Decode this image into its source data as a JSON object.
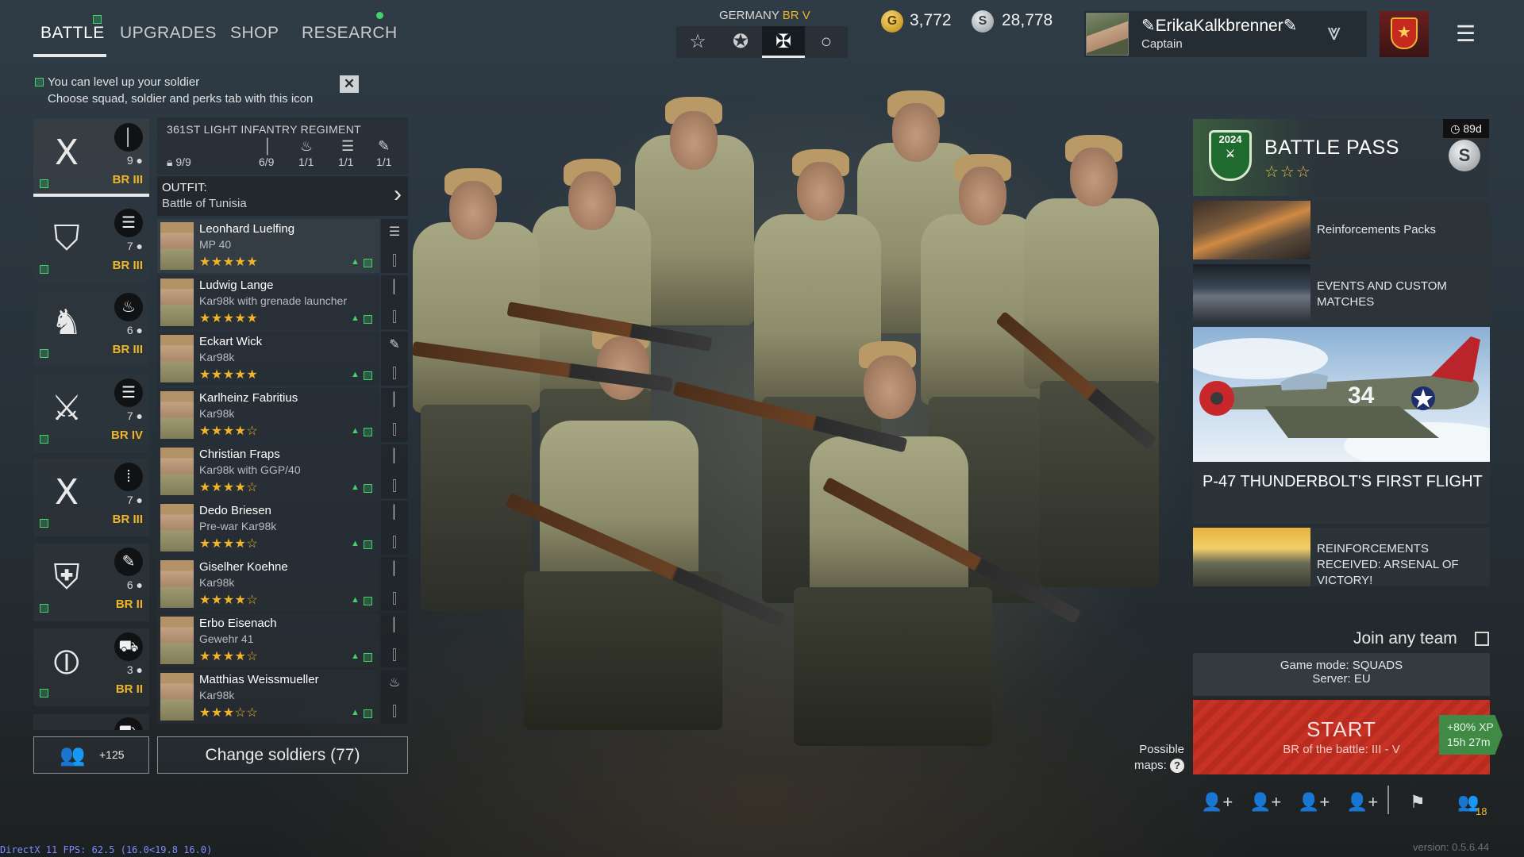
{
  "nav": {
    "tabs": [
      {
        "label": "BATTLE",
        "active": true
      },
      {
        "label": "UPGRADES"
      },
      {
        "label": "SHOP"
      },
      {
        "label": "RESEARCH"
      }
    ]
  },
  "hint": {
    "line1": "You can level up your soldier",
    "line2": "Choose squad, soldier and perks tab with this icon"
  },
  "nation": {
    "name": "GERMANY",
    "br": "BR V",
    "buttons": [
      "star-icon",
      "roundel-star-icon",
      "iron-cross-icon",
      "circle-icon"
    ]
  },
  "currency": {
    "gold_symbol": "G",
    "gold": "3,772",
    "silver_symbol": "S",
    "silver": "28,778"
  },
  "profile": {
    "nickname": "ErikaKalkbrenner",
    "rank": "Captain"
  },
  "squads": [
    {
      "emblem": "Ⅹ",
      "type_icon": "rifle-icon",
      "type_glyph": "│",
      "count": "9",
      "br": "BR III",
      "selected": true
    },
    {
      "emblem": "⛉",
      "type_icon": "list-icon",
      "type_glyph": "☰",
      "count": "7",
      "br": "BR III"
    },
    {
      "emblem": "♞",
      "type_icon": "flame-icon",
      "type_glyph": "♨",
      "count": "6",
      "br": "BR III"
    },
    {
      "emblem": "⚔",
      "type_icon": "list-icon",
      "type_glyph": "☰",
      "count": "7",
      "br": "BR IV"
    },
    {
      "emblem": "Ⅹ",
      "type_icon": "ammo-icon",
      "type_glyph": "⁞",
      "count": "7",
      "br": "BR III"
    },
    {
      "emblem": "⛨",
      "type_icon": "wrench-icon",
      "type_glyph": "✎",
      "count": "6",
      "br": "BR II"
    },
    {
      "emblem": "⦶",
      "type_icon": "tank-icon",
      "type_glyph": "⛟",
      "count": "3",
      "br": "BR II"
    }
  ],
  "squad_bottom": {
    "label": "+125"
  },
  "regiment": {
    "name": "361ST LIGHT INFANTRY REGIMENT",
    "lock_count": "9/9",
    "stats": [
      {
        "icon": "rifle-icon",
        "glyph": "│",
        "value": "6/9"
      },
      {
        "icon": "flame-icon",
        "glyph": "♨",
        "value": "1/1"
      },
      {
        "icon": "list-icon",
        "glyph": "☰",
        "value": "1/1"
      },
      {
        "icon": "wrench-icon",
        "glyph": "✎",
        "value": "1/1"
      }
    ]
  },
  "outfit": {
    "label": "OUTFIT:",
    "value": "Battle of Tunisia"
  },
  "soldiers": [
    {
      "name": "Leonhard Luelfing",
      "weapon": "MP 40",
      "stars": "★★★★★",
      "slot_icon": "☰"
    },
    {
      "name": "Ludwig Lange",
      "weapon": "Kar98k with grenade launcher",
      "stars": "★★★★★",
      "slot_icon": "│"
    },
    {
      "name": "Eckart Wick",
      "weapon": "Kar98k",
      "stars": "★★★★★",
      "slot_icon": "✎"
    },
    {
      "name": "Karlheinz Fabritius",
      "weapon": "Kar98k",
      "stars": "★★★★☆",
      "slot_icon": "│"
    },
    {
      "name": "Christian Fraps",
      "weapon": "Kar98k with GGP/40",
      "stars": "★★★★☆",
      "slot_icon": "│"
    },
    {
      "name": "Dedo Briesen",
      "weapon": "Pre-war Kar98k",
      "stars": "★★★★☆",
      "slot_icon": "│"
    },
    {
      "name": "Giselher Koehne",
      "weapon": "Kar98k",
      "stars": "★★★★☆",
      "slot_icon": "│"
    },
    {
      "name": "Erbo Eisenach",
      "weapon": "Gewehr 41",
      "stars": "★★★★☆",
      "slot_icon": "│"
    },
    {
      "name": "Matthias Weissmueller",
      "weapon": "Kar98k",
      "stars": "★★★☆☆",
      "slot_icon": "♨"
    }
  ],
  "change_soldiers": {
    "label": "Change soldiers (77)"
  },
  "battle_pass": {
    "title": "BATTLE PASS",
    "stars": "☆☆☆",
    "days": "89d",
    "year": "2024",
    "coin_symbol": "S"
  },
  "news": [
    {
      "text": "Reinforcements Packs"
    },
    {
      "text": "EVENTS AND CUSTOM MATCHES"
    },
    {
      "text": "P-47 THUNDERBOLT'S FIRST FLIGHT",
      "plane_number": "34"
    },
    {
      "text": "REINFORCEMENTS RECEIVED: ARSENAL OF VICTORY!"
    }
  ],
  "join": {
    "label": "Join any team",
    "checked": false
  },
  "mode": {
    "game_mode": "Game mode: SQUADS",
    "server": "Server: EU"
  },
  "start": {
    "label": "START",
    "sub": "BR of the battle: III - V",
    "xp": "+80% XP",
    "timer": "15h 27m"
  },
  "maps": {
    "label": "Possible maps:"
  },
  "party": {
    "count": "18"
  },
  "debug": {
    "fps": "DirectX 11 FPS: 62.5 (16.0<19.8 16.0)",
    "version": "version: 0.5.6.44"
  },
  "colors": {
    "accent_green": "#43d26a",
    "br_gold": "#f0b429",
    "start_red": "#c73224"
  }
}
